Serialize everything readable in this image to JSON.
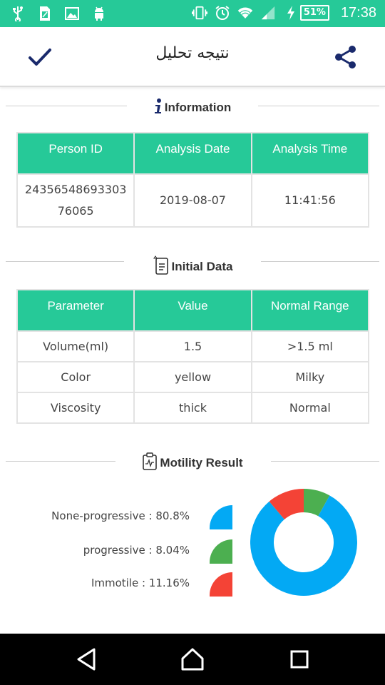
{
  "status_bar": {
    "battery": "51%",
    "time": "17:38",
    "left_icons": [
      "usb-icon",
      "sim-icon",
      "image-icon",
      "android-icon"
    ],
    "right_icons": [
      "vibrate-icon",
      "alarm-icon",
      "wifi-icon",
      "signal-icon",
      "charging-icon"
    ]
  },
  "app_bar": {
    "title": "نتیجه تحلیل",
    "left_icon": "check-icon",
    "right_icon": "share-icon"
  },
  "information": {
    "title": "Information",
    "headers": [
      "Person ID",
      "Analysis Date",
      "Analysis Time"
    ],
    "person_id_line1": "24356548693303",
    "person_id_line2": "76065",
    "analysis_date": "2019-08-07",
    "analysis_time": "11:41:56"
  },
  "initial_data": {
    "title": "Initial Data",
    "headers": [
      "Parameter",
      "Value",
      "Normal Range"
    ],
    "rows": [
      [
        "Volume(ml)",
        "1.5",
        ">1.5 ml"
      ],
      [
        "Color",
        "yellow",
        "Milky"
      ],
      [
        "Viscosity",
        "thick",
        "Normal"
      ]
    ]
  },
  "motility": {
    "title": "Motility Result",
    "legend": [
      {
        "label": "None-progressive : 80.8%",
        "color": "#03a9f4"
      },
      {
        "label": "progressive : 8.04%",
        "color": "#4caf50"
      },
      {
        "label": "Immotile : 11.16%",
        "color": "#f44336"
      }
    ]
  },
  "chart_data": {
    "type": "pie",
    "title": "",
    "categories": [
      "None-progressive",
      "progressive",
      "Immotile"
    ],
    "values": [
      80.8,
      8.04,
      11.16
    ],
    "colors": [
      "#03a9f4",
      "#4caf50",
      "#f44336"
    ]
  },
  "nav_bar": {
    "icons": [
      "back-icon",
      "home-icon",
      "recents-icon"
    ]
  },
  "colors": {
    "accent": "#26c998",
    "primary_icon": "#1a2a6c"
  }
}
